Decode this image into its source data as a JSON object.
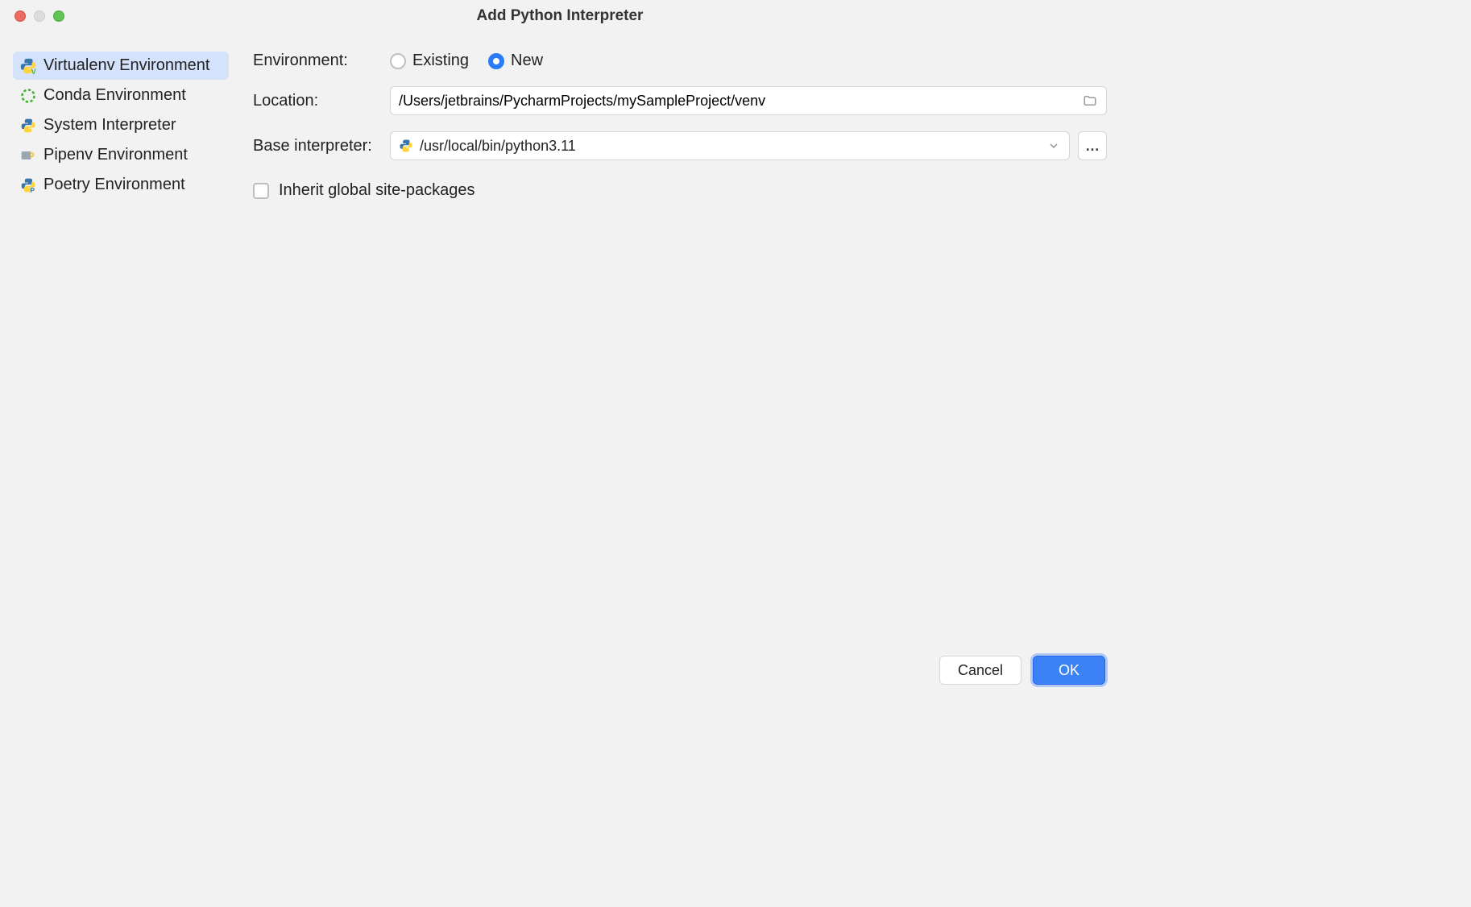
{
  "window": {
    "title": "Add Python Interpreter"
  },
  "sidebar": {
    "items": [
      {
        "label": "Virtualenv Environment",
        "selected": true
      },
      {
        "label": "Conda Environment",
        "selected": false
      },
      {
        "label": "System Interpreter",
        "selected": false
      },
      {
        "label": "Pipenv Environment",
        "selected": false
      },
      {
        "label": "Poetry Environment",
        "selected": false
      }
    ]
  },
  "form": {
    "environment": {
      "label": "Environment:",
      "options": {
        "existing": "Existing",
        "new": "New"
      },
      "selected": "new"
    },
    "location": {
      "label": "Location:",
      "value": "/Users/jetbrains/PycharmProjects/mySampleProject/venv"
    },
    "base_interpreter": {
      "label": "Base interpreter:",
      "value": "/usr/local/bin/python3.11"
    },
    "inherit": {
      "label": "Inherit global site-packages",
      "checked": false
    }
  },
  "footer": {
    "cancel": "Cancel",
    "ok": "OK"
  }
}
